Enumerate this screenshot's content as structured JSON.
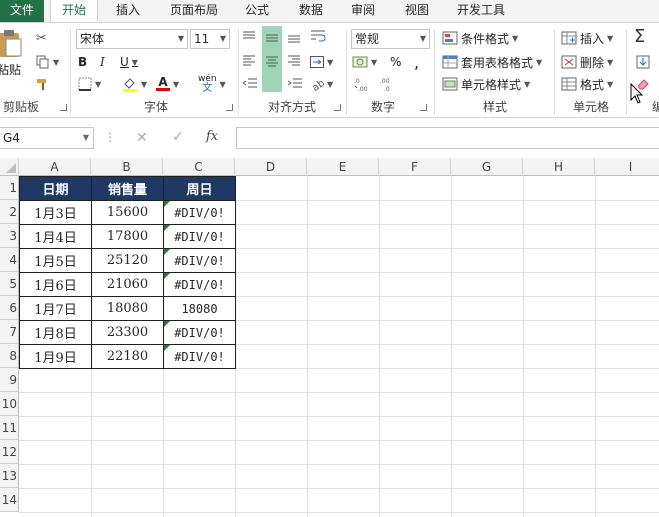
{
  "tabs": [
    "文件",
    "开始",
    "插入",
    "页面布局",
    "公式",
    "数据",
    "审阅",
    "视图",
    "开发工具"
  ],
  "ribbon": {
    "clipboard": {
      "paste": "粘贴",
      "label": "剪贴板"
    },
    "font": {
      "name": "宋体",
      "size": "11",
      "bold": "B",
      "italic": "I",
      "underline": "U",
      "font_color_glyph": "A",
      "phonetic": "wén",
      "label": "字体"
    },
    "alignment": {
      "label": "对齐方式"
    },
    "number": {
      "format": "常规",
      "percent": "%",
      "label": "数字"
    },
    "styles": {
      "conditional": "条件格式",
      "table": "套用表格格式",
      "cell_styles": "单元格样式",
      "label": "样式"
    },
    "cells": {
      "insert": "插入",
      "delete": "删除",
      "format": "格式",
      "label": "单元格"
    },
    "editing": {
      "sum_glyph": "Σ"
    },
    "partial_label": "编"
  },
  "formula_bar": {
    "name_box": "G4",
    "fx": "fx",
    "value": ""
  },
  "columns": [
    "A",
    "B",
    "C",
    "D",
    "E",
    "F",
    "G",
    "H",
    "I"
  ],
  "rows": [
    "1",
    "2",
    "3",
    "4",
    "5",
    "6",
    "7",
    "8",
    "9",
    "10",
    "11",
    "12",
    "13",
    "14"
  ],
  "table": {
    "headers": [
      "日期",
      "销售量",
      "周日"
    ],
    "rows": [
      {
        "date": "1月3日",
        "sales": "15600",
        "sunday": "#DIV/0!"
      },
      {
        "date": "1月4日",
        "sales": "17800",
        "sunday": "#DIV/0!"
      },
      {
        "date": "1月5日",
        "sales": "25120",
        "sunday": "#DIV/0!"
      },
      {
        "date": "1月6日",
        "sales": "21060",
        "sunday": "#DIV/0!"
      },
      {
        "date": "1月7日",
        "sales": "18080",
        "sunday": "18080"
      },
      {
        "date": "1月8日",
        "sales": "23300",
        "sunday": "#DIV/0!"
      },
      {
        "date": "1月9日",
        "sales": "22180",
        "sunday": "#DIV/0!"
      }
    ]
  },
  "colors": {
    "brand": "#217346",
    "header_fill": "#1f3864",
    "error_marker": "#2e7d32"
  }
}
